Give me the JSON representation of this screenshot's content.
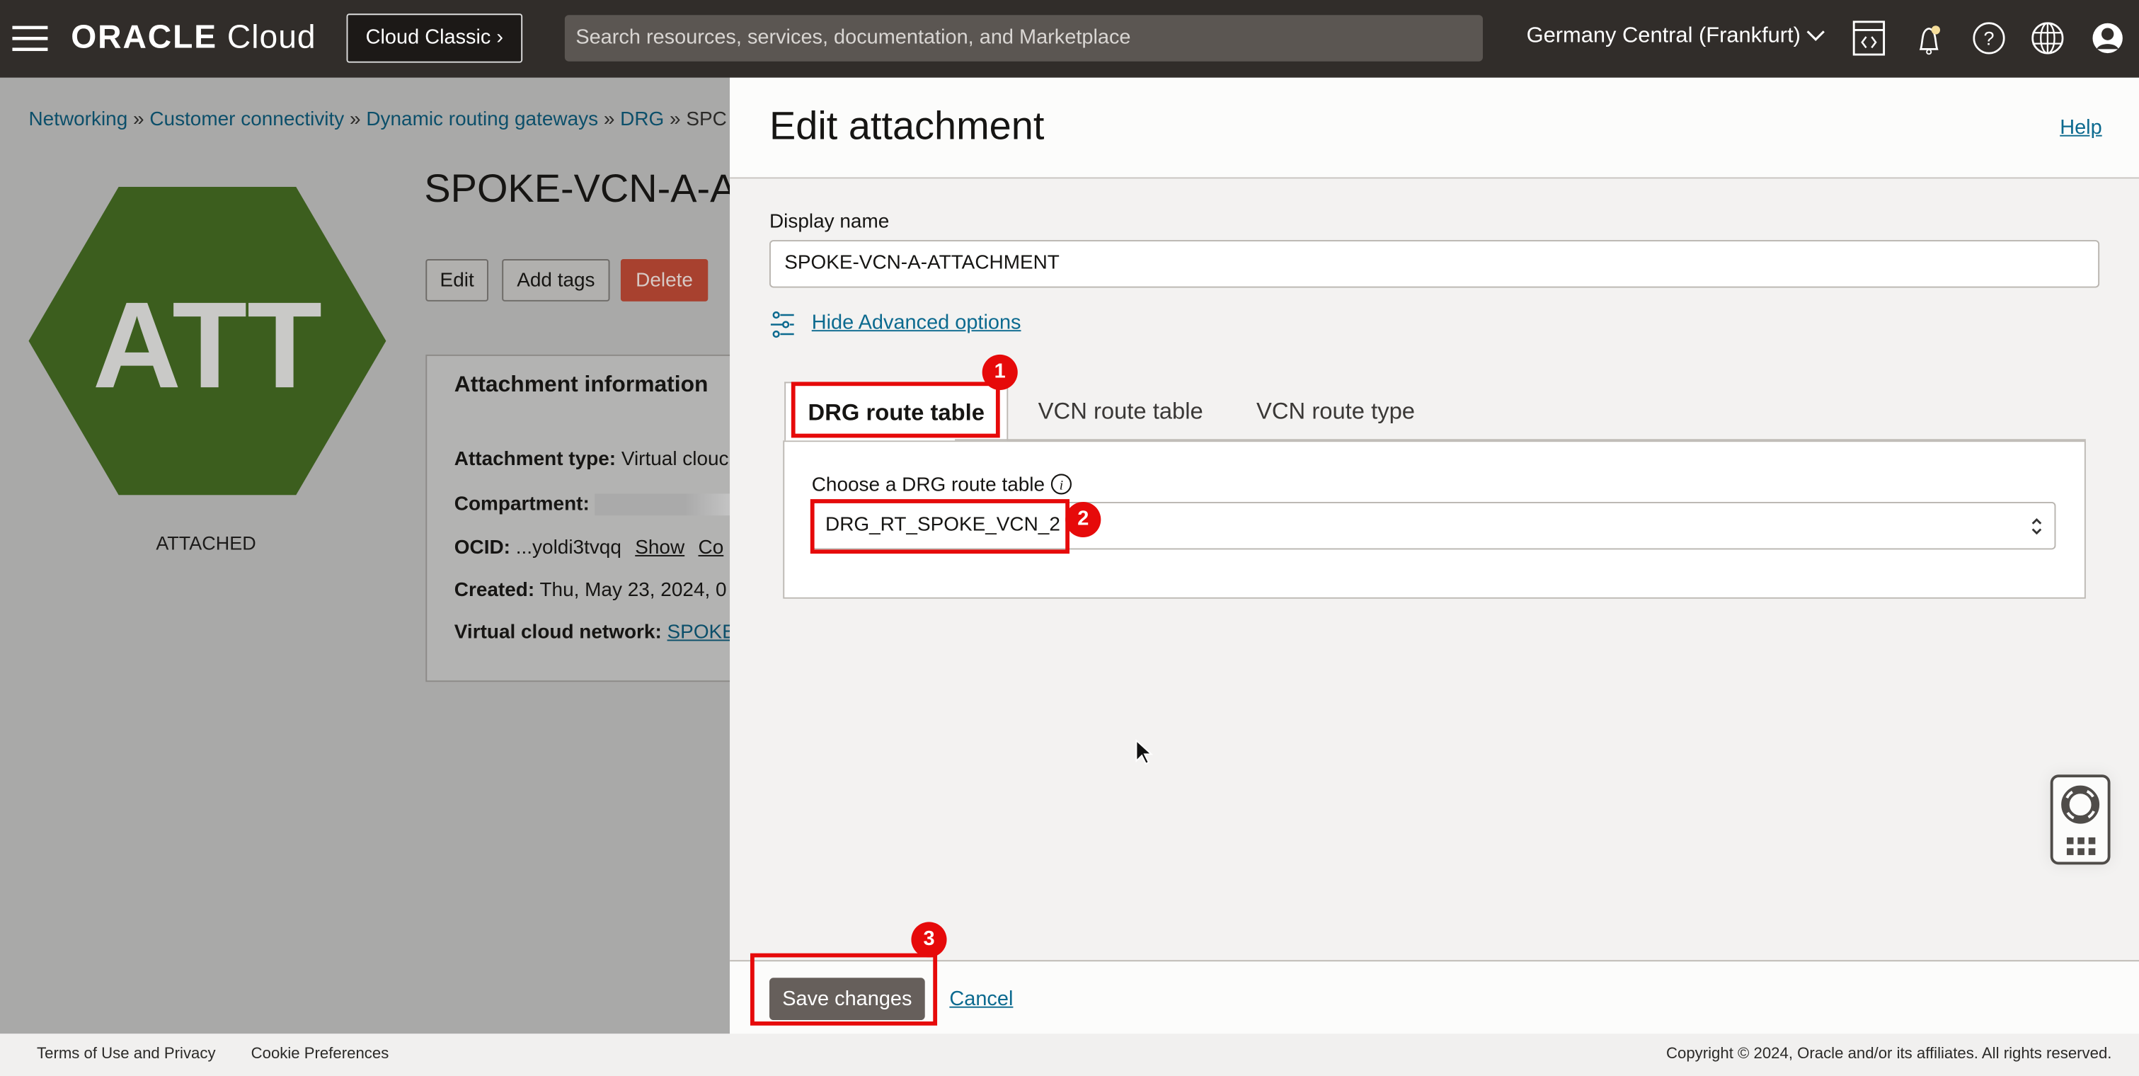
{
  "topbar": {
    "logo_word": "ORACLE",
    "logo_cloud": "Cloud",
    "cloud_classic_label": "Cloud Classic",
    "search_placeholder": "Search resources, services, documentation, and Marketplace",
    "region": "Germany Central (Frankfurt)",
    "icons": [
      "menu-icon",
      "code-editor-icon",
      "bell-icon",
      "help-icon",
      "globe-icon",
      "user-avatar-icon"
    ],
    "notification_dot_color": "#f5dd9a"
  },
  "page": {
    "breadcrumb": [
      "Networking",
      "Customer connectivity",
      "Dynamic routing gateways",
      "DRG",
      "SPC"
    ],
    "hex_label": "ATT",
    "hex_color": "#3c5e1e",
    "status": "ATTACHED",
    "title": "SPOKE-VCN-A-A",
    "buttons": {
      "edit": "Edit",
      "add_tags": "Add tags",
      "delete": "Delete"
    },
    "info": {
      "heading": "Attachment information",
      "attachment_type_label": "Attachment type:",
      "attachment_type_value": "Virtual clouc",
      "compartment_label": "Compartment:",
      "ocid_label": "OCID:",
      "ocid_value": "...yoldi3tvqq",
      "ocid_show": "Show",
      "ocid_copy": "Co",
      "created_label": "Created:",
      "created_value": "Thu, May 23, 2024, 0",
      "vcn_label": "Virtual cloud network:",
      "vcn_value": "SPOKE"
    }
  },
  "panel": {
    "title": "Edit attachment",
    "help": "Help",
    "display_name_label": "Display name",
    "display_name_value": "SPOKE-VCN-A-ATTACHMENT",
    "advanced_link": "Hide Advanced options",
    "tabs": [
      {
        "label": "DRG route table",
        "active": true
      },
      {
        "label": "VCN route table",
        "active": false
      },
      {
        "label": "VCN route type",
        "active": false
      }
    ],
    "route_table_label": "Choose a DRG route table",
    "route_table_value": "DRG_RT_SPOKE_VCN_2",
    "save": "Save changes",
    "cancel": "Cancel"
  },
  "annotations": [
    "1",
    "2",
    "3"
  ],
  "annotation_color": "#e60a0a",
  "footer": {
    "terms": "Terms of Use and Privacy",
    "cookies": "Cookie Preferences",
    "copyright": "Copyright © 2024, Oracle and/or its affiliates. All rights reserved."
  }
}
